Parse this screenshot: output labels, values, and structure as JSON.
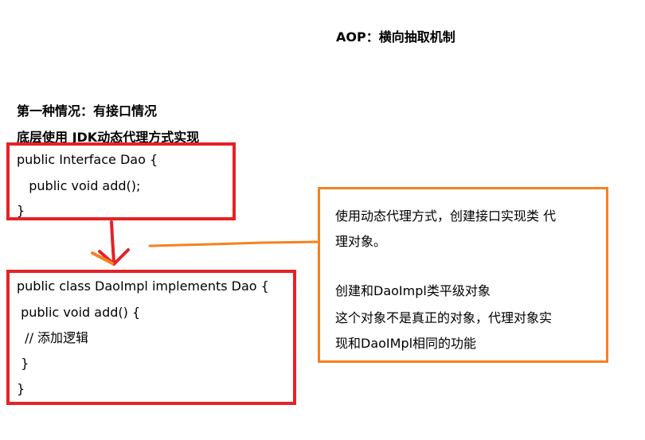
{
  "title": "AOP：横向抽取机制",
  "headings": [
    "第一种情况：有接口情况",
    "底层使用 JDK动态代理方式实现"
  ],
  "interface_code": [
    "public Interface Dao {",
    "   public void add();",
    "}"
  ],
  "impl_code": [
    "public class DaoImpl implements Dao {",
    " public void add() {",
    "  // 添加逻辑",
    " }",
    "}"
  ],
  "note_lines": [
    "使用动态代理方式，创建接口实现类 代",
    "理对象。",
    "",
    "创建和DaoImpl类平级对象",
    "这个对象不是真正的对象，代理对象实",
    "现和DaoIMpl相同的功能"
  ],
  "colors": {
    "red_box": "#e52226",
    "orange_box": "#f58220"
  }
}
